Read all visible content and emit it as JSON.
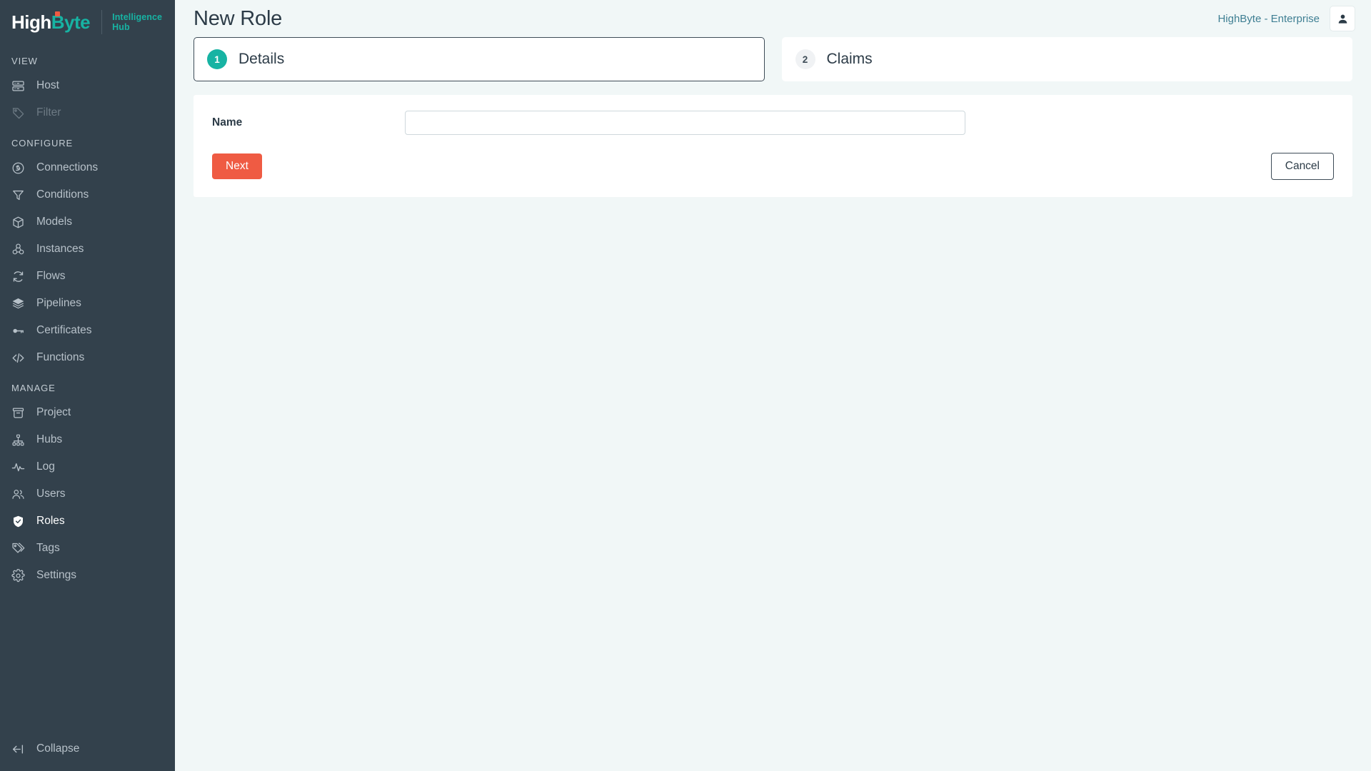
{
  "brand": {
    "name_part1": "High",
    "name_part2": "Byte",
    "subtitle_line1": "Intelligence",
    "subtitle_line2": "Hub",
    "accent_teal": "#17b3a3",
    "accent_orange": "#ef5b43",
    "sidebar_bg": "#33414c",
    "page_bg": "#f1f7f7"
  },
  "sidebar": {
    "sections": [
      {
        "title": "VIEW",
        "items": [
          {
            "label": "Host",
            "icon": "server-icon",
            "state": "normal"
          },
          {
            "label": "Filter",
            "icon": "tag-icon",
            "state": "disabled"
          }
        ]
      },
      {
        "title": "CONFIGURE",
        "items": [
          {
            "label": "Connections",
            "icon": "plug-circle-icon",
            "state": "normal"
          },
          {
            "label": "Conditions",
            "icon": "funnel-icon",
            "state": "normal"
          },
          {
            "label": "Models",
            "icon": "box-icon",
            "state": "normal"
          },
          {
            "label": "Instances",
            "icon": "boxes-cluster-icon",
            "state": "normal"
          },
          {
            "label": "Flows",
            "icon": "refresh-circle-icon",
            "state": "normal"
          },
          {
            "label": "Pipelines",
            "icon": "layers-icon",
            "state": "normal"
          },
          {
            "label": "Certificates",
            "icon": "key-icon",
            "state": "normal"
          },
          {
            "label": "Functions",
            "icon": "code-brackets-icon",
            "state": "normal"
          }
        ]
      },
      {
        "title": "MANAGE",
        "items": [
          {
            "label": "Project",
            "icon": "archive-icon",
            "state": "normal"
          },
          {
            "label": "Hubs",
            "icon": "hierarchy-icon",
            "state": "normal"
          },
          {
            "label": "Log",
            "icon": "activity-pulse-icon",
            "state": "normal"
          },
          {
            "label": "Users",
            "icon": "users-icon",
            "state": "normal"
          },
          {
            "label": "Roles",
            "icon": "shield-check-icon",
            "state": "active"
          },
          {
            "label": "Tags",
            "icon": "tags-icon",
            "state": "normal"
          },
          {
            "label": "Settings",
            "icon": "gear-icon",
            "state": "normal"
          }
        ]
      }
    ],
    "collapse_label": "Collapse",
    "collapse_icon": "arrow-to-left-icon"
  },
  "header": {
    "title": "New Role",
    "tenant": "HighByte - Enterprise",
    "user_icon": "person-icon"
  },
  "steps": [
    {
      "number": "1",
      "label": "Details",
      "state": "active"
    },
    {
      "number": "2",
      "label": "Claims",
      "state": "inactive"
    }
  ],
  "form": {
    "name_label": "Name",
    "name_value": "",
    "name_placeholder": "",
    "next_label": "Next",
    "cancel_label": "Cancel"
  }
}
